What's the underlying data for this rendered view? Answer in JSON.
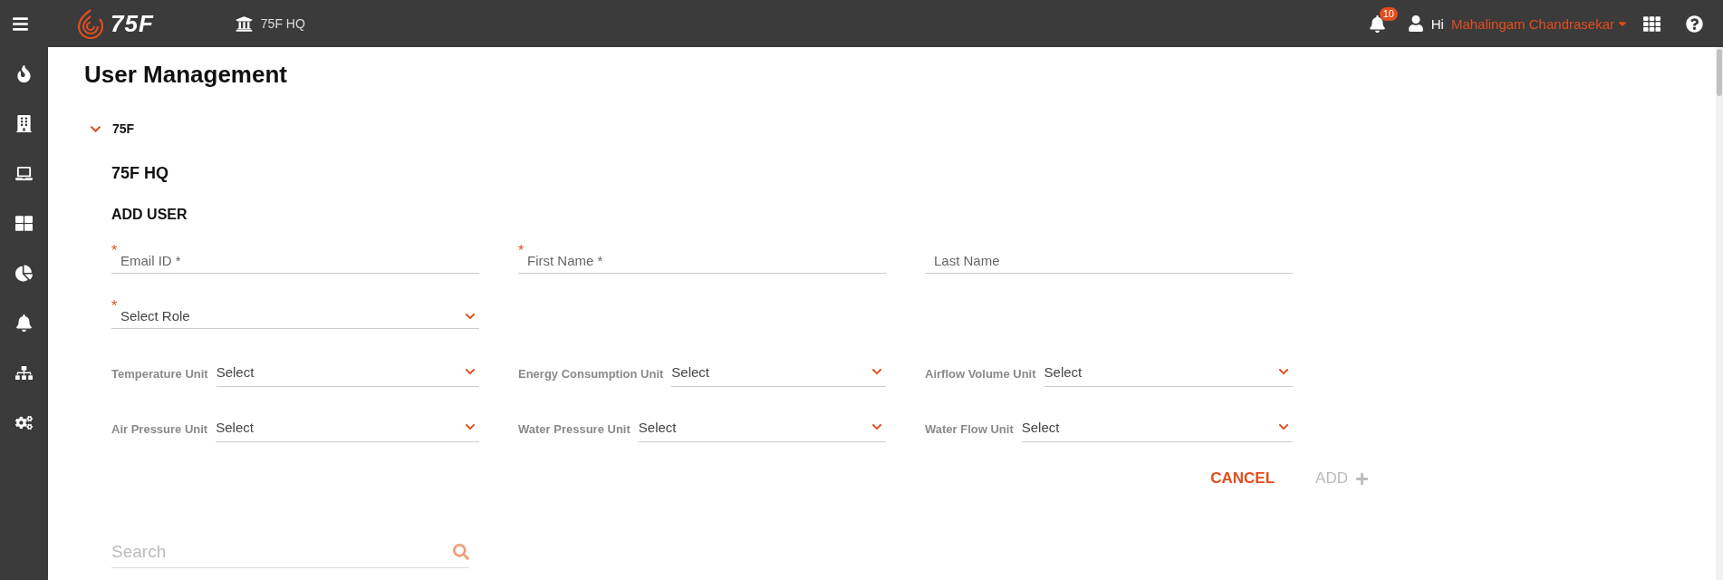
{
  "top_bar": {
    "brand": "75F",
    "site": "75F HQ",
    "notifications": "10",
    "greeting": "Hi",
    "user_name": "Mahalingam Chandrasekar"
  },
  "page": {
    "title": "User Management"
  },
  "tree": {
    "label": "75F",
    "expanded": true
  },
  "site_title": "75F HQ",
  "form": {
    "title": "ADD USER",
    "required_mark": "*",
    "text_fields": [
      {
        "placeholder": "Email ID *",
        "required": true
      },
      {
        "placeholder": "First Name *",
        "required": true
      },
      {
        "placeholder": "Last Name",
        "required": false
      }
    ],
    "role_select": {
      "placeholder": "Select Role",
      "required": true
    },
    "unit_selects": [
      {
        "label": "Temperature Unit",
        "value": "Select"
      },
      {
        "label": "Energy Consumption Unit",
        "value": "Select"
      },
      {
        "label": "Airflow Volume Unit",
        "value": "Select"
      },
      {
        "label": "Air Pressure Unit",
        "value": "Select"
      },
      {
        "label": "Water Pressure Unit",
        "value": "Select"
      },
      {
        "label": "Water Flow Unit",
        "value": "Select"
      }
    ],
    "actions": [
      {
        "kind": "cancel",
        "label": "CANCEL",
        "disabled": false
      },
      {
        "kind": "add",
        "label": "ADD",
        "disabled": true
      }
    ]
  },
  "search": {
    "placeholder": "Search"
  }
}
